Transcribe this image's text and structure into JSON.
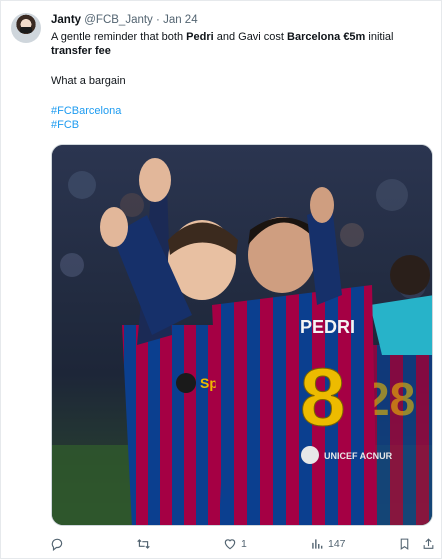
{
  "tweet": {
    "author_name": "Janty",
    "author_handle": "@FCB_Janty",
    "separator": "·",
    "date": "Jan 24",
    "text": {
      "t1": "A gentle reminder that both ",
      "b1": "Pedri",
      "t2": " and Gavi cost ",
      "b2": "Barcelona",
      "t3": " ",
      "b3": "€5m",
      "t4": " initial",
      "b4": "transfer fee",
      "line3": "What a bargain",
      "hashtag1": "#FCBarcelona",
      "hashtag2": "#FCB"
    },
    "photo": {
      "jersey_name": "PEDRI",
      "jersey_number": "8",
      "sponsor": "Spotify",
      "sleeve_text": "UNICEF ACNUR"
    },
    "actions": {
      "reply_icon": "reply-icon",
      "retweet_icon": "retweet-icon",
      "like_icon": "heart-icon",
      "like_count": "1",
      "views_icon": "views-icon",
      "views_count": "147",
      "bookmark_icon": "bookmark-icon",
      "share_icon": "share-icon"
    }
  },
  "colors": {
    "link": "#1d9bf0",
    "muted": "#536471",
    "text": "#0f1419",
    "jersey_red": "#a50044",
    "jersey_blue": "#004d98",
    "jersey_gold": "#edbb00"
  }
}
